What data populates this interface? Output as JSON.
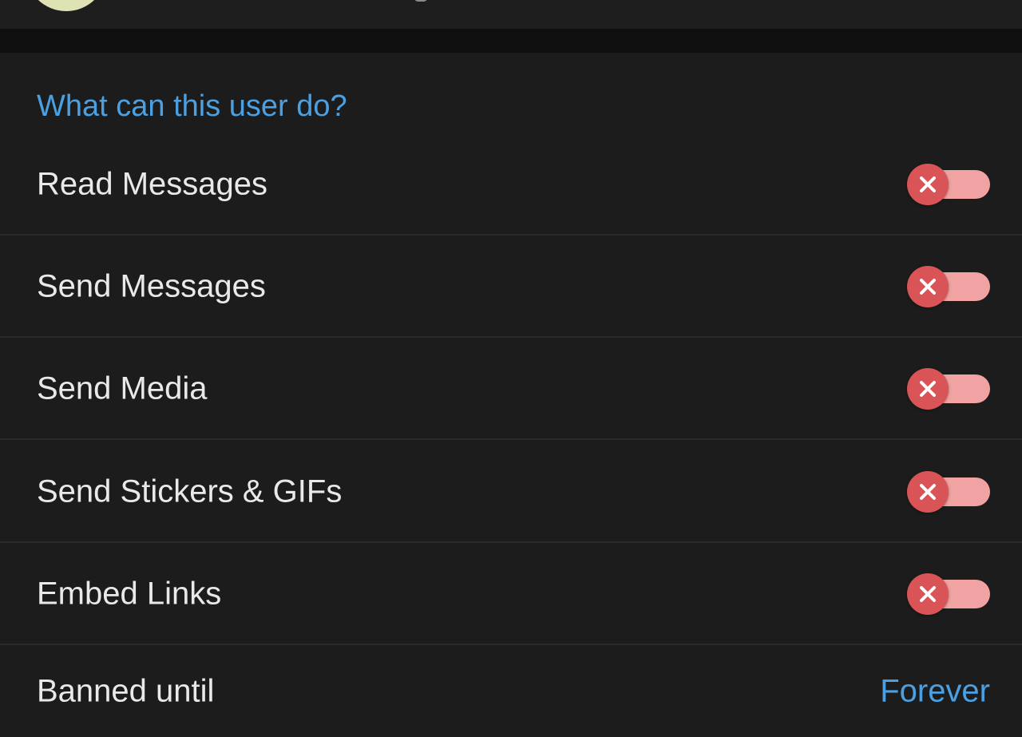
{
  "section": {
    "header": "What can this user do?"
  },
  "permissions": [
    {
      "label": "Read Messages",
      "enabled": false,
      "toggle_icon": "close-icon"
    },
    {
      "label": "Send Messages",
      "enabled": false,
      "toggle_icon": "close-icon"
    },
    {
      "label": "Send Media",
      "enabled": false,
      "toggle_icon": "close-icon"
    },
    {
      "label": "Send Stickers & GIFs",
      "enabled": false,
      "toggle_icon": "close-icon"
    },
    {
      "label": "Embed Links",
      "enabled": false,
      "toggle_icon": "close-icon"
    }
  ],
  "banned": {
    "label": "Banned until",
    "value": "Forever"
  },
  "colors": {
    "background": "#1c1c1c",
    "accent": "#4aa0e2",
    "toggle_off_knob": "#d95457",
    "toggle_off_track": "#f1a3a3",
    "text": "#e9e9e9"
  }
}
